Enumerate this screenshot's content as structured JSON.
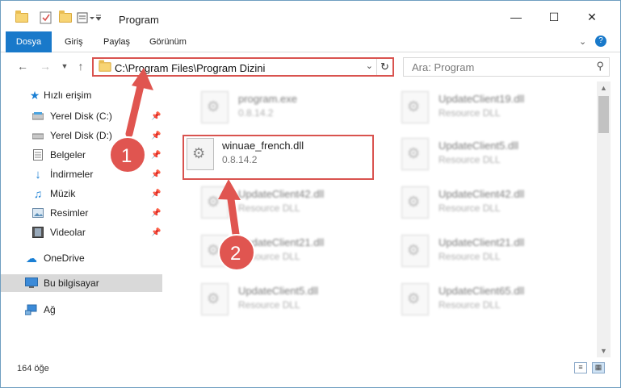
{
  "window": {
    "title": "Program"
  },
  "ribbon": {
    "tabs": [
      "Dosya",
      "Giriş",
      "Paylaş",
      "Görünüm"
    ]
  },
  "address": {
    "path": "C:\\Program Files\\Program Dizini"
  },
  "search": {
    "placeholder": "Ara: Program"
  },
  "nav_pane": {
    "quick_access": "Hızlı erişim",
    "items": [
      {
        "label": "Yerel Disk (C:)",
        "icon": "drive-icon",
        "pinned": true
      },
      {
        "label": "Yerel Disk (D:)",
        "icon": "drive-icon",
        "pinned": true
      },
      {
        "label": "Belgeler",
        "icon": "documents-icon",
        "pinned": true
      },
      {
        "label": "İndirmeler",
        "icon": "download-icon",
        "pinned": true
      },
      {
        "label": "Müzik",
        "icon": "music-icon",
        "pinned": true
      },
      {
        "label": "Resimler",
        "icon": "pictures-icon",
        "pinned": true
      },
      {
        "label": "Videolar",
        "icon": "videos-icon",
        "pinned": true
      }
    ],
    "onedrive": "OneDrive",
    "this_pc": "Bu bilgisayar",
    "network": "Ağ"
  },
  "files": [
    {
      "name": "program.exe",
      "desc": "0.8.14.2"
    },
    {
      "name": "UpdateClient19.dll",
      "desc": "Resource DLL"
    },
    {
      "name": "winuae_french.dll",
      "desc": "0.8.14.2"
    },
    {
      "name": "UpdateClient5.dll",
      "desc": "Resource DLL"
    },
    {
      "name": "UpdateClient42.dll",
      "desc": "Resource DLL"
    },
    {
      "name": "UpdateClient42.dll",
      "desc": "Resource DLL"
    },
    {
      "name": "UpdateClient21.dll",
      "desc": "Resource DLL"
    },
    {
      "name": "UpdateClient21.dll",
      "desc": "Resource DLL"
    },
    {
      "name": "UpdateClient5.dll",
      "desc": "Resource DLL"
    },
    {
      "name": "UpdateClient65.dll",
      "desc": "Resource DLL"
    }
  ],
  "status": {
    "count": "164 öğe"
  },
  "annotations": {
    "step1": "1",
    "step2": "2",
    "color": "#e05550"
  }
}
